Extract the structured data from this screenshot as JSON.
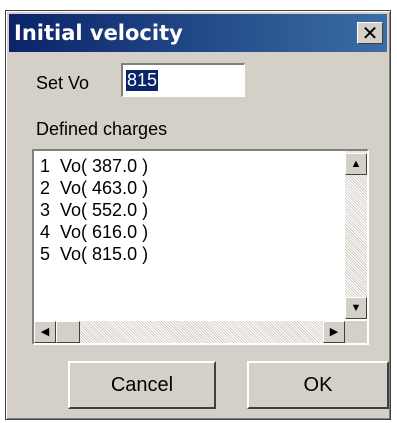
{
  "window": {
    "title": "Initial velocity",
    "close_glyph": "✕"
  },
  "vo": {
    "label": "Set Vo",
    "value": "815"
  },
  "charges": {
    "label": "Defined charges",
    "items": [
      "1  Vo( 387.0 )",
      "2  Vo( 463.0 )",
      "3  Vo( 552.0 )",
      "4  Vo( 616.0 )",
      "5  Vo( 815.0 )"
    ]
  },
  "scroll": {
    "up": "▲",
    "down": "▼",
    "left": "◀",
    "right": "▶"
  },
  "buttons": {
    "cancel": "Cancel",
    "ok": "OK"
  }
}
